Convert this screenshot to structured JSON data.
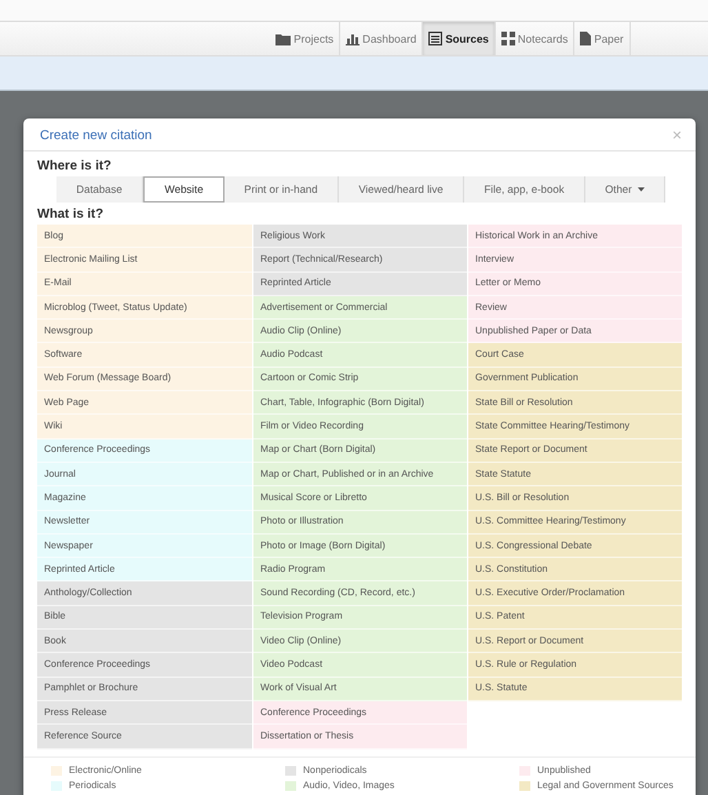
{
  "nav": [
    {
      "label": "Projects",
      "kind": "folder",
      "selected": false
    },
    {
      "label": "Dashboard",
      "kind": "chart",
      "selected": false
    },
    {
      "label": "Sources",
      "kind": "list",
      "selected": true
    },
    {
      "label": "Notecards",
      "kind": "grid",
      "selected": false
    },
    {
      "label": "Paper",
      "kind": "file",
      "selected": false
    }
  ],
  "modal": {
    "title": "Create new citation",
    "close": "×",
    "where_label": "Where is it?",
    "where_tabs": [
      {
        "label": "Database",
        "kind": "plain",
        "selected": false
      },
      {
        "label": "Website",
        "kind": "plain",
        "selected": true
      },
      {
        "label": "Print or in-hand",
        "kind": "plain",
        "selected": false
      },
      {
        "label": "Viewed/heard live",
        "kind": "plain",
        "selected": false
      },
      {
        "label": "File, app, e-book",
        "kind": "plain",
        "selected": false
      },
      {
        "label": "Other",
        "kind": "dropdown",
        "selected": false
      }
    ],
    "what_label": "What is it?",
    "columns": [
      [
        {
          "label": "Blog",
          "color": "#fdf3e3"
        },
        {
          "label": "Electronic Mailing List",
          "color": "#fdf3e3"
        },
        {
          "label": "E-Mail",
          "color": "#fdf3e3"
        },
        {
          "label": "Microblog (Tweet, Status Update)",
          "color": "#fdf3e3"
        },
        {
          "label": "Newsgroup",
          "color": "#fdf3e3"
        },
        {
          "label": "Software",
          "color": "#fdf3e3"
        },
        {
          "label": "Web Forum (Message Board)",
          "color": "#fdf3e3"
        },
        {
          "label": "Web Page",
          "color": "#fdf3e3"
        },
        {
          "label": "Wiki",
          "color": "#fdf3e3"
        },
        {
          "label": "Conference Proceedings",
          "color": "#e6fbfc"
        },
        {
          "label": "Journal",
          "color": "#e6fbfc"
        },
        {
          "label": "Magazine",
          "color": "#e6fbfc"
        },
        {
          "label": "Newsletter",
          "color": "#e6fbfc"
        },
        {
          "label": "Newspaper",
          "color": "#e6fbfc"
        },
        {
          "label": "Reprinted Article",
          "color": "#e6fbfc"
        },
        {
          "label": "Anthology/Collection",
          "color": "#e4e4e4"
        },
        {
          "label": "Bible",
          "color": "#e4e4e4"
        },
        {
          "label": "Book",
          "color": "#e4e4e4"
        },
        {
          "label": "Conference Proceedings",
          "color": "#e4e4e4"
        },
        {
          "label": "Pamphlet or Brochure",
          "color": "#e4e4e4"
        },
        {
          "label": "Press Release",
          "color": "#e4e4e4"
        },
        {
          "label": "Reference Source",
          "color": "#e4e4e4"
        }
      ],
      [
        {
          "label": "Religious Work",
          "color": "#e4e4e4"
        },
        {
          "label": "Report (Technical/Research)",
          "color": "#e4e4e4"
        },
        {
          "label": "Reprinted Article",
          "color": "#e4e4e4"
        },
        {
          "label": "Advertisement or Commercial",
          "color": "#e3f4d9"
        },
        {
          "label": "Audio Clip (Online)",
          "color": "#e3f4d9"
        },
        {
          "label": "Audio Podcast",
          "color": "#e3f4d9"
        },
        {
          "label": "Cartoon or Comic Strip",
          "color": "#e3f4d9"
        },
        {
          "label": "Chart, Table, Infographic (Born Digital)",
          "color": "#e3f4d9"
        },
        {
          "label": "Film or Video Recording",
          "color": "#e3f4d9"
        },
        {
          "label": "Map or Chart (Born Digital)",
          "color": "#e3f4d9"
        },
        {
          "label": "Map or Chart, Published or in an Archive",
          "color": "#e3f4d9"
        },
        {
          "label": "Musical Score or Libretto",
          "color": "#e3f4d9"
        },
        {
          "label": "Photo or Illustration",
          "color": "#e3f4d9"
        },
        {
          "label": "Photo or Image (Born Digital)",
          "color": "#e3f4d9"
        },
        {
          "label": "Radio Program",
          "color": "#e3f4d9"
        },
        {
          "label": "Sound Recording (CD, Record, etc.)",
          "color": "#e3f4d9"
        },
        {
          "label": "Television Program",
          "color": "#e3f4d9"
        },
        {
          "label": "Video Clip (Online)",
          "color": "#e3f4d9"
        },
        {
          "label": "Video Podcast",
          "color": "#e3f4d9"
        },
        {
          "label": "Work of Visual Art",
          "color": "#e3f4d9"
        },
        {
          "label": "Conference Proceedings",
          "color": "#fdebef"
        },
        {
          "label": "Dissertation or Thesis",
          "color": "#fdebef"
        }
      ],
      [
        {
          "label": "Historical Work in an Archive",
          "color": "#fdebef"
        },
        {
          "label": "Interview",
          "color": "#fdebef"
        },
        {
          "label": "Letter or Memo",
          "color": "#fdebef"
        },
        {
          "label": "Review",
          "color": "#fdebef"
        },
        {
          "label": "Unpublished Paper or Data",
          "color": "#fdebef"
        },
        {
          "label": "Court Case",
          "color": "#f3e9c4"
        },
        {
          "label": "Government Publication",
          "color": "#f3e9c4"
        },
        {
          "label": "State Bill or Resolution",
          "color": "#f3e9c4"
        },
        {
          "label": "State Committee Hearing/Testimony",
          "color": "#f3e9c4"
        },
        {
          "label": "State Report or Document",
          "color": "#f3e9c4"
        },
        {
          "label": "State Statute",
          "color": "#f3e9c4"
        },
        {
          "label": "U.S. Bill or Resolution",
          "color": "#f3e9c4"
        },
        {
          "label": "U.S. Committee Hearing/Testimony",
          "color": "#f3e9c4"
        },
        {
          "label": "U.S. Congressional Debate",
          "color": "#f3e9c4"
        },
        {
          "label": "U.S. Constitution",
          "color": "#f3e9c4"
        },
        {
          "label": "U.S. Executive Order/Proclamation",
          "color": "#f3e9c4"
        },
        {
          "label": "U.S. Patent",
          "color": "#f3e9c4"
        },
        {
          "label": "U.S. Report or Document",
          "color": "#f3e9c4"
        },
        {
          "label": "U.S. Rule or Regulation",
          "color": "#f3e9c4"
        },
        {
          "label": "U.S. Statute",
          "color": "#f3e9c4"
        }
      ]
    ],
    "legend": [
      {
        "label": "Electronic/Online",
        "color": "#fdf3e3"
      },
      {
        "label": "Periodicals",
        "color": "#e6fbfc"
      },
      {
        "label": "Nonperiodicals",
        "color": "#e4e4e4"
      },
      {
        "label": "Audio, Video, Images",
        "color": "#e3f4d9"
      },
      {
        "label": "Unpublished",
        "color": "#fdebef"
      },
      {
        "label": "Legal and Government Sources",
        "color": "#f3e9c4"
      }
    ]
  }
}
